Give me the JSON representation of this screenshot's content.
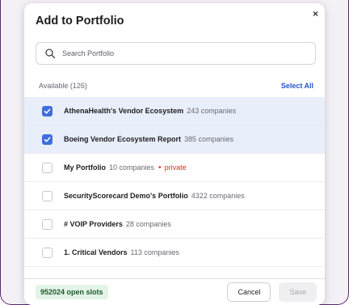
{
  "modal": {
    "title": "Add to Portfolio",
    "close_label": "×"
  },
  "search": {
    "placeholder": "Search Portfolio"
  },
  "list_header": {
    "available": "Available (126)",
    "select_all": "Select All"
  },
  "items": [
    {
      "name": "AthenaHealth's Vendor Ecosystem",
      "count": "243 companies",
      "checked": true
    },
    {
      "name": "Boeing Vendor Ecosystem Report",
      "count": "385 companies",
      "checked": true
    },
    {
      "name": "My Portfolio",
      "count": "10 companies",
      "checked": false,
      "tag": "private"
    },
    {
      "name": "SecurityScorecard Demo's Portfolio",
      "count": "4322 companies",
      "checked": false
    },
    {
      "name": "# VOIP Providers",
      "count": "28 companies",
      "checked": false
    },
    {
      "name": "1. Critical Vendors",
      "count": "113 companies",
      "checked": false
    }
  ],
  "footer": {
    "slots": "952024 open slots",
    "cancel_label": "Cancel",
    "save_label": "Save"
  }
}
